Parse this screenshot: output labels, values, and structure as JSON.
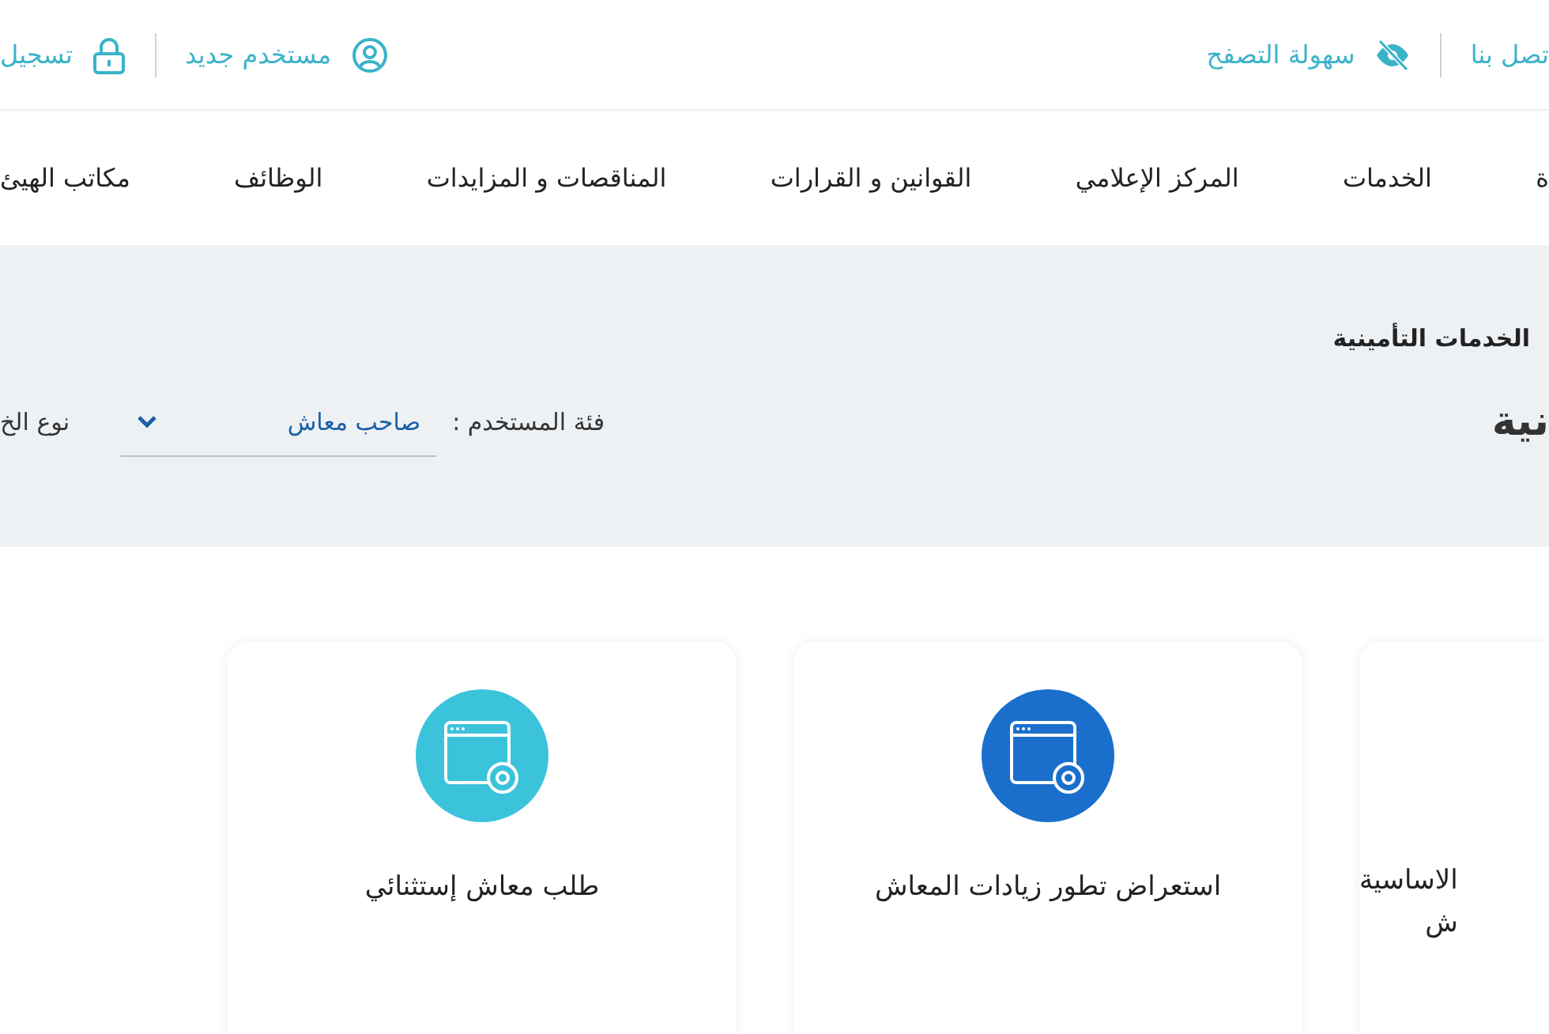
{
  "top_bar": {
    "right_links": [
      {
        "label": "تصل بنا",
        "kind": "plain"
      },
      {
        "label": "سهولة التصفح",
        "kind": "accessibility"
      }
    ],
    "left_links": [
      {
        "label": "مستخدم جديد",
        "kind": "register"
      },
      {
        "label": "تسجيل",
        "kind": "login"
      }
    ]
  },
  "nav": {
    "items": [
      "ة",
      "الخدمات",
      "المركز الإعلامي",
      "القوانين و القرارات",
      "المناقصات و المزايدات",
      "الوظائف",
      "مكاتب الهيئ"
    ]
  },
  "breadcrumb": "الخدمات التأمينية",
  "page_title": "نية",
  "filters": {
    "user_category_label": "فئة المستخدم :",
    "user_category_value": "صاحب معاش",
    "service_type_label": "نوع الخ"
  },
  "cards": [
    {
      "kind": "partial",
      "title_lines": [
        "الاساسية",
        "ش"
      ]
    },
    {
      "kind": "full",
      "title_lines": [
        "استعراض تطور زيادات المعاش"
      ],
      "color": "#1a6fcc"
    },
    {
      "kind": "full",
      "title_lines": [
        "طلب معاش إستثنائي"
      ],
      "color": "#3cc3dc"
    }
  ]
}
